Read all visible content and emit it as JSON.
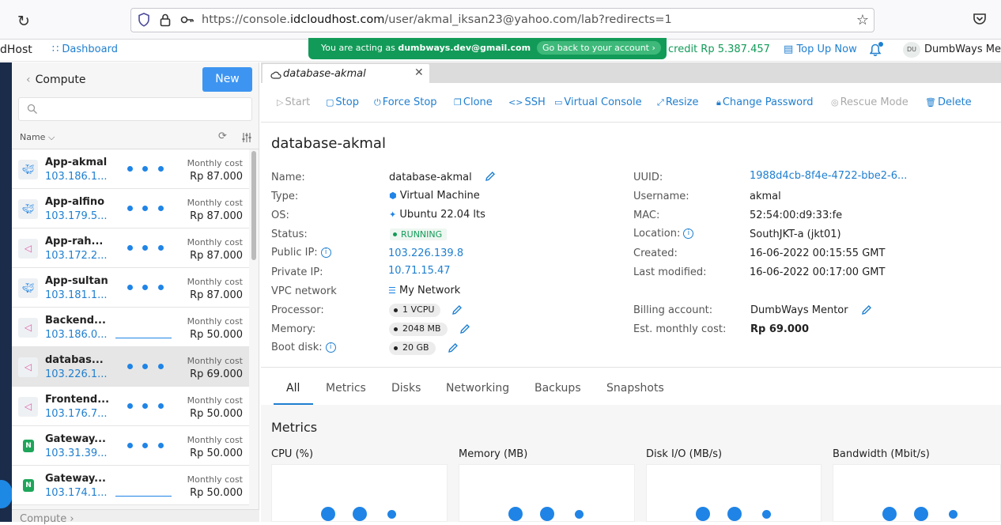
{
  "browser": {
    "url_prefix": "https://console.",
    "url_domain": "idcloudhost.com",
    "url_path": "/user/akmal_iksan23@yahoo.com/lab?redirects=1"
  },
  "header": {
    "brand": "dHost",
    "dashboard": "Dashboard",
    "acting_prefix": "You are acting as ",
    "acting_email": "dumbways.dev@gmail.com",
    "go_back": "Go back to your account ›",
    "credit": "credit Rp 5.387.457",
    "topup": "Top Up Now",
    "avatar": "DU",
    "user": "DumbWays Me"
  },
  "sidebar": {
    "title": "Compute",
    "new_button": "New",
    "column_name": "Name",
    "footer": "Compute  ›",
    "items": [
      {
        "name": "App-akmal",
        "ip": "103.186.1...",
        "cost_label": "Monthly cost",
        "price": "Rp 87.000",
        "icon": "docker-icon",
        "loading": "dots"
      },
      {
        "name": "App-alfino",
        "ip": "103.179.5...",
        "cost_label": "Monthly cost",
        "price": "Rp 87.000",
        "icon": "docker-icon",
        "loading": "dots"
      },
      {
        "name": "App-rah...",
        "ip": "103.172.2...",
        "cost_label": "Monthly cost",
        "price": "Rp 87.000",
        "icon": "vm-icon",
        "loading": "dots"
      },
      {
        "name": "App-sultan",
        "ip": "103.181.1...",
        "cost_label": "Monthly cost",
        "price": "Rp 87.000",
        "icon": "docker-icon",
        "loading": "dots"
      },
      {
        "name": "Backend...",
        "ip": "103.186.0...",
        "cost_label": "Monthly cost",
        "price": "Rp 50.000",
        "icon": "vm-icon",
        "loading": "line"
      },
      {
        "name": "databas...",
        "ip": "103.226.1...",
        "cost_label": "Monthly cost",
        "price": "Rp 69.000",
        "icon": "vm-icon",
        "loading": "dots"
      },
      {
        "name": "Frontend...",
        "ip": "103.176.7...",
        "cost_label": "Monthly cost",
        "price": "Rp 50.000",
        "icon": "vm-icon",
        "loading": "dots"
      },
      {
        "name": "Gateway...",
        "ip": "103.31.39...",
        "cost_label": "Monthly cost",
        "price": "Rp 50.000",
        "icon": "nginx-icon",
        "loading": "dots"
      },
      {
        "name": "Gateway...",
        "ip": "103.174.1...",
        "cost_label": "Monthly cost",
        "price": "Rp 50.000",
        "icon": "nginx-icon",
        "loading": "line"
      }
    ]
  },
  "main": {
    "tab_title": "database-akmal",
    "toolbar": {
      "start": "Start",
      "stop": "Stop",
      "force_stop": "Force Stop",
      "clone": "Clone",
      "ssh": "SSH",
      "virtual_console": "Virtual Console",
      "resize": "Resize",
      "change_password": "Change Password",
      "rescue_mode": "Rescue Mode",
      "delete": "Delete"
    },
    "vm_name": "database-akmal",
    "details_left": {
      "name_label": "Name:",
      "name": "database-akmal",
      "type_label": "Type:",
      "type": "Virtual Machine",
      "os_label": "OS:",
      "os": "Ubuntu 22.04 lts",
      "status_label": "Status:",
      "status": "RUNNING",
      "public_ip_label": "Public IP:",
      "public_ip": "103.226.139.8",
      "private_ip_label": "Private IP:",
      "private_ip": "10.71.15.47",
      "vpc_label": "VPC network",
      "vpc": "My Network",
      "processor_label": "Processor:",
      "processor": "1 VCPU",
      "memory_label": "Memory:",
      "memory": "2048 MB",
      "boot_disk_label": "Boot disk:",
      "boot_disk": "20 GB"
    },
    "details_right": {
      "uuid_label": "UUID:",
      "uuid": "1988d4cb-8f4e-4722-bbe2-6...",
      "username_label": "Username:",
      "username": "akmal",
      "mac_label": "MAC:",
      "mac": "52:54:00:d9:33:fe",
      "location_label": "Location:",
      "location": "SouthJKT-a (jkt01)",
      "created_label": "Created:",
      "created": "16-06-2022 00:15:55 GMT",
      "modified_label": "Last modified:",
      "modified": "16-06-2022 00:17:00 GMT",
      "billing_label": "Billing account:",
      "billing": "DumbWays Mentor",
      "cost_label": "Est. monthly cost:",
      "cost": "Rp 69.000"
    },
    "tabs": [
      "All",
      "Metrics",
      "Disks",
      "Networking",
      "Backups",
      "Snapshots"
    ],
    "metrics_title": "Metrics",
    "metrics": [
      "CPU (%)",
      "Memory (MB)",
      "Disk I/O (MB/s)",
      "Bandwidth (Mbit/s)"
    ]
  },
  "colors": {
    "accent": "#1f7fd0",
    "green": "#129b58",
    "new_button": "#3d95f1"
  }
}
